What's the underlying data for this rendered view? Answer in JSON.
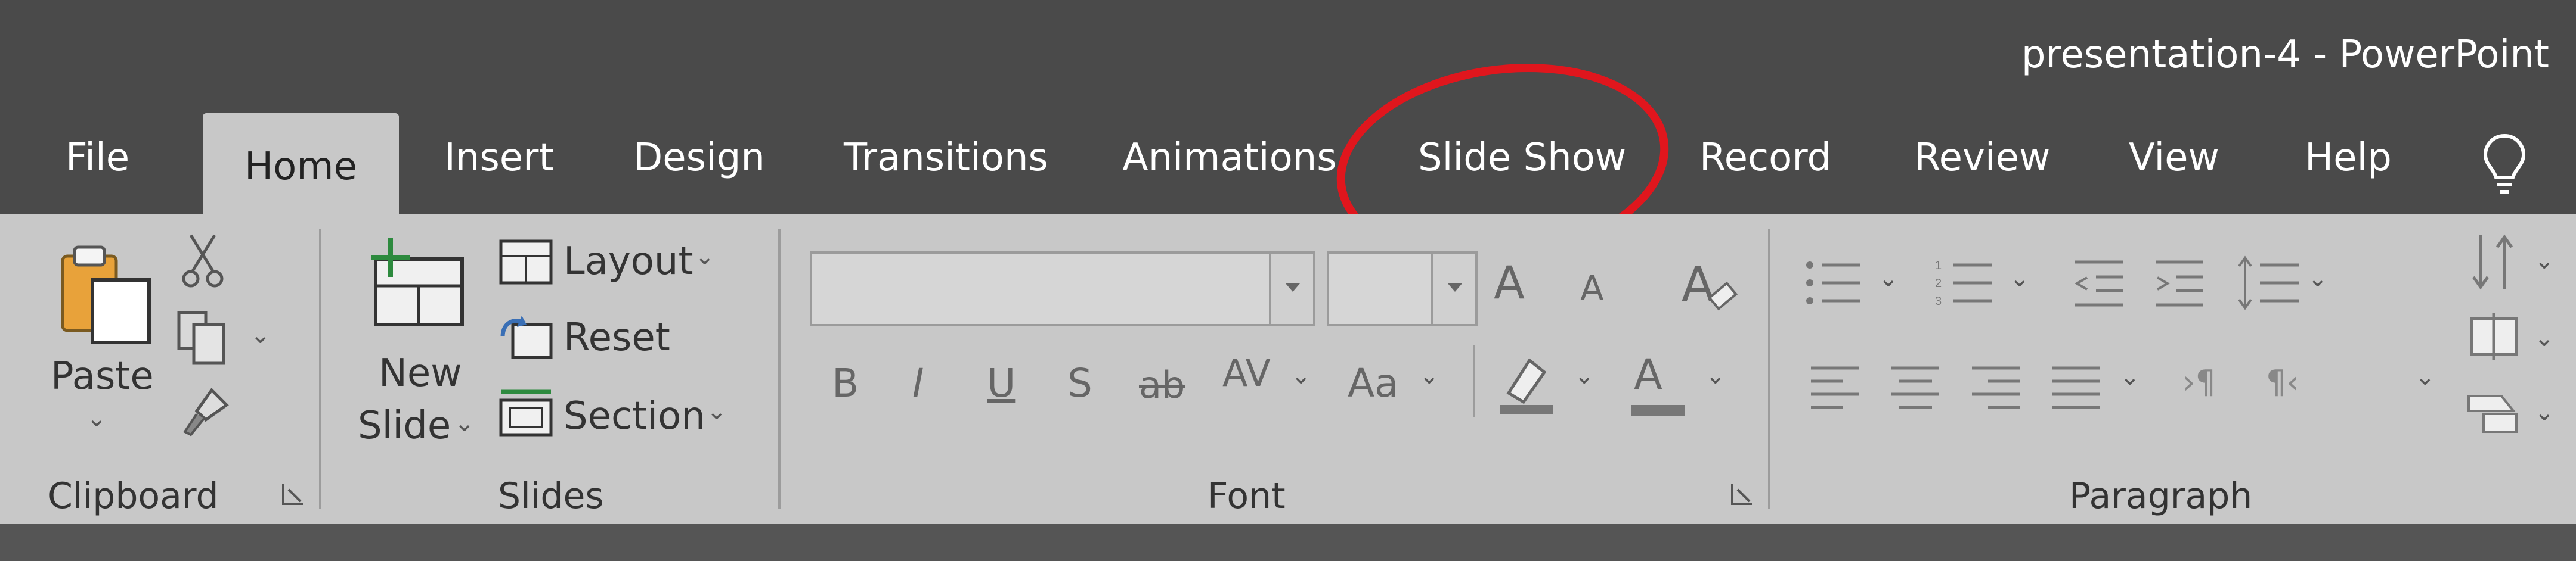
{
  "window": {
    "title": "presentation-4  -  PowerPoint"
  },
  "tabs": [
    {
      "label": "File"
    },
    {
      "label": "Home"
    },
    {
      "label": "Insert"
    },
    {
      "label": "Design"
    },
    {
      "label": "Transitions"
    },
    {
      "label": "Animations"
    },
    {
      "label": "Slide Show"
    },
    {
      "label": "Record"
    },
    {
      "label": "Review"
    },
    {
      "label": "View"
    },
    {
      "label": "Help"
    }
  ],
  "active_tab": "Home",
  "annotation": {
    "target": "Slide Show",
    "color": "#e0161d"
  },
  "clipboard": {
    "paste": "Paste",
    "group": "Clipboard"
  },
  "slides": {
    "new_slide_line1": "New",
    "new_slide_line2": "Slide",
    "layout": "Layout",
    "reset": "Reset",
    "section": "Section",
    "group": "Slides"
  },
  "font": {
    "font_name": "",
    "font_size": "",
    "increase": "A",
    "decrease": "A",
    "bold": "B",
    "italic": "I",
    "underline": "U",
    "shadow": "S",
    "strikethrough": "ab",
    "spacing": "AV",
    "change_case": "Aa",
    "font_color": "A",
    "group": "Font"
  },
  "paragraph": {
    "group": "Paragraph"
  }
}
